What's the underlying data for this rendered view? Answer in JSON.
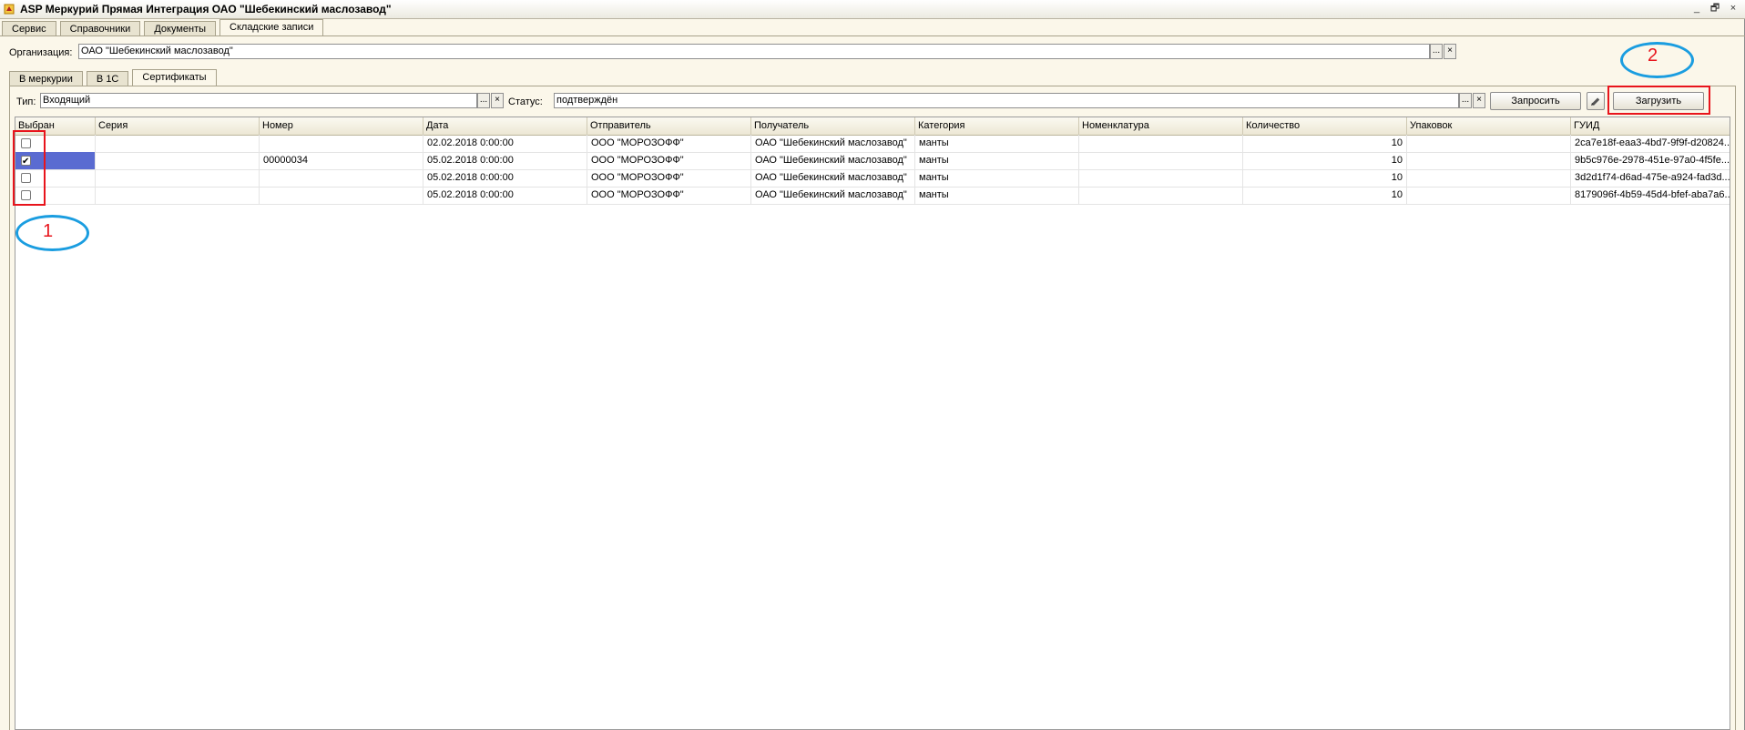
{
  "window": {
    "title": "ASP Меркурий Прямая Интеграция ОАО \"Шебекинский маслозавод\"",
    "controls": [
      "_",
      "🗗",
      "×"
    ]
  },
  "main_tabs": [
    {
      "label": "Сервис",
      "active": false
    },
    {
      "label": "Справочники",
      "active": false
    },
    {
      "label": "Документы",
      "active": false
    },
    {
      "label": "Складские записи",
      "active": true
    }
  ],
  "organization": {
    "label": "Организация:",
    "value": "ОАО \"Шебекинский маслозавод\""
  },
  "sub_tabs": [
    {
      "label": "В меркурии",
      "active": false
    },
    {
      "label": "В 1С",
      "active": false
    },
    {
      "label": "Сертификаты",
      "active": true
    }
  ],
  "filters": {
    "type_label": "Тип:",
    "type_value": "Входящий",
    "status_label": "Статус:",
    "status_value": "подтверждён",
    "request_button": "Запросить",
    "load_button": "Загрузить",
    "ellipsis": "...",
    "clear": "×"
  },
  "annotations": {
    "first": "1",
    "second": "2"
  },
  "table": {
    "columns": [
      "Выбран",
      "Серия",
      "Номер",
      "Дата",
      "Отправитель",
      "Получатель",
      "Категория",
      "Номенклатура",
      "Количество",
      "Упаковок",
      "ГУИД"
    ],
    "rows": [
      {
        "checked": false,
        "selected": false,
        "series": "",
        "number": "",
        "date": "02.02.2018 0:00:00",
        "sender": "ООО \"МОРОЗОФФ\"",
        "recipient": "ОАО \"Шебекинский маслозавод\"",
        "category": "манты",
        "nomenclature": "",
        "quantity": "10",
        "packages": "",
        "guid": "2ca7e18f-eaa3-4bd7-9f9f-d20824..."
      },
      {
        "checked": true,
        "selected": true,
        "series": "",
        "number": "00000034",
        "date": "05.02.2018 0:00:00",
        "sender": "ООО \"МОРОЗОФФ\"",
        "recipient": "ОАО \"Шебекинский маслозавод\"",
        "category": "манты",
        "nomenclature": "",
        "quantity": "10",
        "packages": "",
        "guid": "9b5c976e-2978-451e-97a0-4f5fe..."
      },
      {
        "checked": false,
        "selected": false,
        "series": "",
        "number": "",
        "date": "05.02.2018 0:00:00",
        "sender": "ООО \"МОРОЗОФФ\"",
        "recipient": "ОАО \"Шебекинский маслозавод\"",
        "category": "манты",
        "nomenclature": "",
        "quantity": "10",
        "packages": "",
        "guid": "3d2d1f74-d6ad-475e-a924-fad3d..."
      },
      {
        "checked": false,
        "selected": false,
        "series": "",
        "number": "",
        "date": "05.02.2018 0:00:00",
        "sender": "ООО \"МОРОЗОФФ\"",
        "recipient": "ОАО \"Шебекинский маслозавод\"",
        "category": "манты",
        "nomenclature": "",
        "quantity": "10",
        "packages": "",
        "guid": "8179096f-4b59-45d4-bfef-aba7a6..."
      }
    ]
  }
}
